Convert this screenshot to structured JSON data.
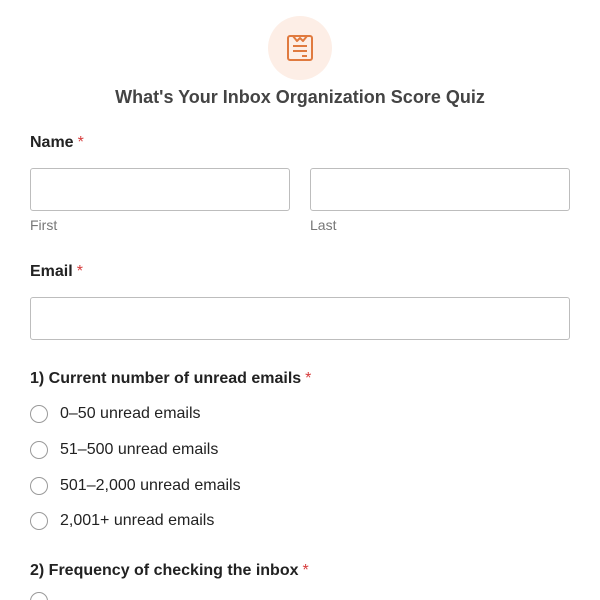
{
  "form": {
    "title": "What's Your Inbox Organization Score Quiz",
    "header_icon": "form-document-icon",
    "accent_color": "#e07a3f"
  },
  "name_field": {
    "label": "Name",
    "required_mark": "*",
    "first": {
      "value": "",
      "sublabel": "First"
    },
    "last": {
      "value": "",
      "sublabel": "Last"
    }
  },
  "email_field": {
    "label": "Email",
    "required_mark": "*",
    "value": ""
  },
  "q1": {
    "label": "1) Current number of unread emails",
    "required_mark": "*",
    "options": [
      "0–50 unread emails",
      "51–500 unread emails",
      "501–2,000 unread emails",
      "2,001+ unread emails"
    ]
  },
  "q2": {
    "label": "2) Frequency of checking the inbox",
    "required_mark": "*"
  }
}
